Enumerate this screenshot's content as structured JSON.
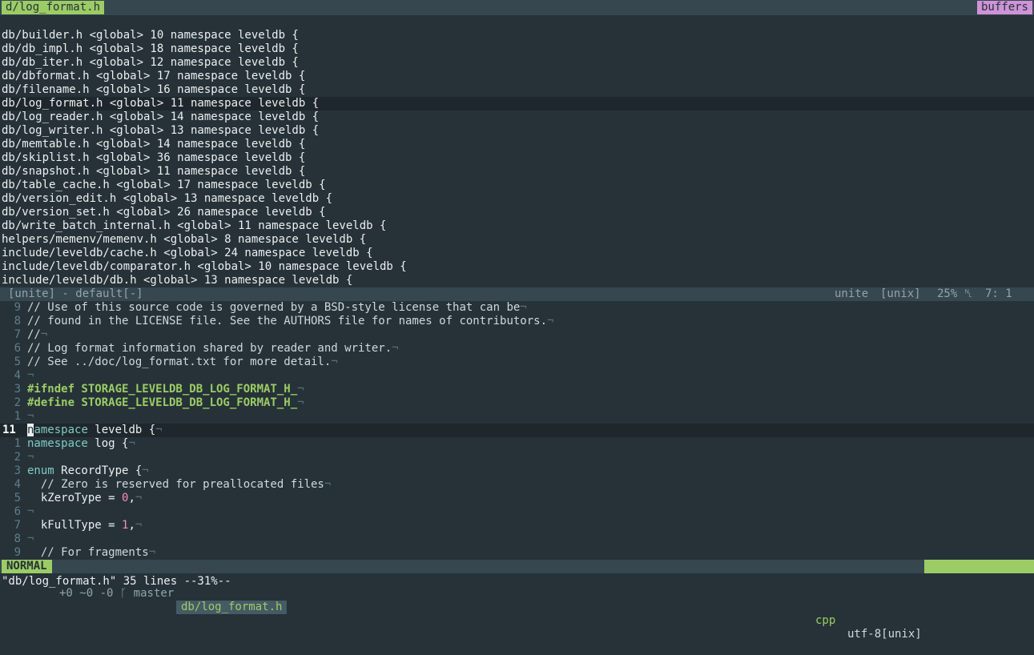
{
  "tabline": {
    "active_tab": "d/log_format.h",
    "buffers_label": "buffers"
  },
  "unite": {
    "items": [
      "db/builder.h <global> 10 namespace leveldb {",
      "db/db_impl.h <global> 18 namespace leveldb {",
      "db/db_iter.h <global> 12 namespace leveldb {",
      "db/dbformat.h <global> 17 namespace leveldb {",
      "db/filename.h <global> 16 namespace leveldb {",
      "db/log_format.h <global> 11 namespace leveldb {",
      "db/log_reader.h <global> 14 namespace leveldb {",
      "db/log_writer.h <global> 13 namespace leveldb {",
      "db/memtable.h <global> 14 namespace leveldb {",
      "db/skiplist.h <global> 36 namespace leveldb {",
      "db/snapshot.h <global> 11 namespace leveldb {",
      "db/table_cache.h <global> 17 namespace leveldb {",
      "db/version_edit.h <global> 13 namespace leveldb {",
      "db/version_set.h <global> 26 namespace leveldb {",
      "db/write_batch_internal.h <global> 11 namespace leveldb {",
      "helpers/memenv/memenv.h <global> 8 namespace leveldb {",
      "include/leveldb/cache.h <global> 24 namespace leveldb {",
      "include/leveldb/comparator.h <global> 10 namespace leveldb {",
      "include/leveldb/db.h <global> 13 namespace leveldb {"
    ],
    "selected_index": 5,
    "statusline": {
      "buffer_name": "[unite] - default[-]",
      "filetype": "unite",
      "fileformat": "[unix]",
      "percent": "25% ␤",
      "line_col": "7:  1"
    }
  },
  "editor": {
    "eol_char": "¬",
    "lines": [
      {
        "num": "9",
        "parts": [
          [
            "comment",
            "// Use of this source code is governed by a BSD-style license that can be"
          ]
        ]
      },
      {
        "num": "8",
        "parts": [
          [
            "comment",
            "// found in the LICENSE file. See the AUTHORS file for names of contributors."
          ]
        ]
      },
      {
        "num": "7",
        "parts": [
          [
            "comment",
            "//"
          ]
        ]
      },
      {
        "num": "6",
        "parts": [
          [
            "comment",
            "// Log format information shared by reader and writer."
          ]
        ]
      },
      {
        "num": "5",
        "parts": [
          [
            "comment",
            "// See ../doc/log_format.txt for more detail."
          ]
        ]
      },
      {
        "num": "4",
        "parts": []
      },
      {
        "num": "3",
        "parts": [
          [
            "pp",
            "#ifndef STORAGE_LEVELDB_DB_LOG_FORMAT_H_"
          ]
        ]
      },
      {
        "num": "2",
        "parts": [
          [
            "pp",
            "#define STORAGE_LEVELDB_DB_LOG_FORMAT_H_"
          ]
        ]
      },
      {
        "num": "1",
        "parts": []
      },
      {
        "num": "11",
        "current": true,
        "parts": [
          [
            "cursor",
            "n"
          ],
          [
            "kw",
            "amespace"
          ],
          [
            "plain",
            " leveldb {"
          ]
        ]
      },
      {
        "num": "1",
        "parts": [
          [
            "kw",
            "namespace"
          ],
          [
            "plain",
            " log {"
          ]
        ]
      },
      {
        "num": "2",
        "parts": []
      },
      {
        "num": "3",
        "parts": [
          [
            "kw",
            "enum"
          ],
          [
            "plain",
            " RecordType {"
          ]
        ]
      },
      {
        "num": "4",
        "parts": [
          [
            "comment",
            "  // Zero is reserved for preallocated files"
          ]
        ]
      },
      {
        "num": "5",
        "parts": [
          [
            "plain",
            "  kZeroType = "
          ],
          [
            "num",
            "0"
          ],
          [
            "plain",
            ","
          ]
        ]
      },
      {
        "num": "6",
        "parts": []
      },
      {
        "num": "7",
        "parts": [
          [
            "plain",
            "  kFullType = "
          ],
          [
            "num",
            "1"
          ],
          [
            "plain",
            ","
          ]
        ]
      },
      {
        "num": "8",
        "parts": []
      },
      {
        "num": "9",
        "parts": [
          [
            "comment",
            "  // For fragments"
          ]
        ]
      }
    ]
  },
  "statusline": {
    "mode": "NORMAL",
    "git": "+0 ~0 -0 ᚴ master",
    "filename": "db/log_format.h",
    "filetype": "cpp",
    "encoding": "utf-8[unix]",
    "percent": "31% ␤",
    "line": "11:",
    "col": "1"
  },
  "message": "\"db/log_format.h\" 35 lines --31%--",
  "colors": {
    "background": "#263238",
    "accent_green": "#9ccc65",
    "accent_pink": "#ce93d8",
    "statusbar": "#37474f"
  }
}
